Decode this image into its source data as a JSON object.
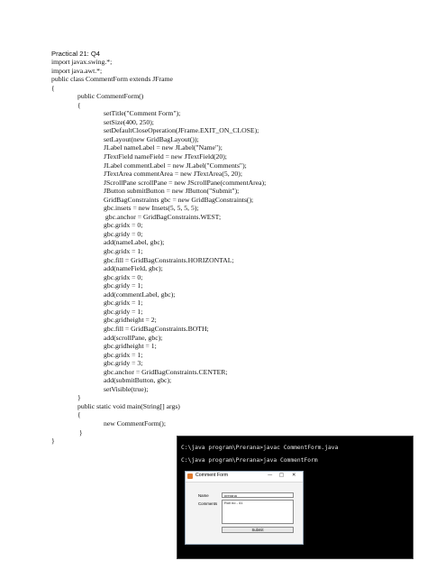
{
  "heading": "Practical 21: Q4",
  "code_lines": [
    {
      "indent": 0,
      "text": "import javax.swing.*;"
    },
    {
      "indent": 0,
      "text": "import java.awt.*;"
    },
    {
      "indent": 0,
      "text": "public class CommentForm extends JFrame"
    },
    {
      "indent": 0,
      "text": "{"
    },
    {
      "indent": 1,
      "text": "public CommentForm()"
    },
    {
      "indent": 1,
      "text": "{"
    },
    {
      "indent": 2,
      "text": "setTitle(\"Comment Form\");"
    },
    {
      "indent": 2,
      "text": "setSize(400, 250);"
    },
    {
      "indent": 2,
      "text": "setDefaultCloseOperation(JFrame.EXIT_ON_CLOSE);"
    },
    {
      "indent": 2,
      "text": "setLayout(new GridBagLayout());"
    },
    {
      "indent": 2,
      "text": "JLabel nameLabel = new JLabel(\"Name\");"
    },
    {
      "indent": 2,
      "text": "JTextField nameField = new JTextField(20);"
    },
    {
      "indent": 2,
      "text": "JLabel commentLabel = new JLabel(\"Comments\");"
    },
    {
      "indent": 2,
      "text": "JTextArea commentArea = new JTextArea(5, 20);"
    },
    {
      "indent": 2,
      "text": "JScrollPane scrollPane = new JScrollPane(commentArea);"
    },
    {
      "indent": 2,
      "text": "JButton submitButton = new JButton(\"Submit\");"
    },
    {
      "indent": 2,
      "text": "GridBagConstraints gbc = new GridBagConstraints();"
    },
    {
      "indent": 2,
      "text": "gbc.insets = new Insets(5, 5, 5, 5);"
    },
    {
      "indent": 2,
      "text": " gbc.anchor = GridBagConstraints.WEST;"
    },
    {
      "indent": 2,
      "text": "gbc.gridx = 0;"
    },
    {
      "indent": 2,
      "text": "gbc.gridy = 0;"
    },
    {
      "indent": 2,
      "text": "add(nameLabel, gbc);"
    },
    {
      "indent": 2,
      "text": "gbc.gridx = 1;"
    },
    {
      "indent": 2,
      "text": "gbc.fill = GridBagConstraints.HORIZONTAL;"
    },
    {
      "indent": 2,
      "text": "add(nameField, gbc);"
    },
    {
      "indent": 2,
      "text": "gbc.gridx = 0;"
    },
    {
      "indent": 2,
      "text": "gbc.gridy = 1;"
    },
    {
      "indent": 2,
      "text": "add(commentLabel, gbc);"
    },
    {
      "indent": 2,
      "text": "gbc.gridx = 1;"
    },
    {
      "indent": 2,
      "text": "gbc.gridy = 1;"
    },
    {
      "indent": 2,
      "text": "gbc.gridheight = 2;"
    },
    {
      "indent": 2,
      "text": "gbc.fill = GridBagConstraints.BOTH;"
    },
    {
      "indent": 2,
      "text": "add(scrollPane, gbc);"
    },
    {
      "indent": 2,
      "text": "gbc.gridheight = 1;"
    },
    {
      "indent": 2,
      "text": "gbc.gridx = 1;"
    },
    {
      "indent": 2,
      "text": "gbc.gridy = 3;"
    },
    {
      "indent": 2,
      "text": "gbc.anchor = GridBagConstraints.CENTER;"
    },
    {
      "indent": 2,
      "text": "add(submitButton, gbc);"
    },
    {
      "indent": 2,
      "text": "setVisible(true);"
    },
    {
      "indent": 1,
      "text": "}"
    },
    {
      "indent": 1,
      "text": "public static void main(String[] args)"
    },
    {
      "indent": 1,
      "text": "{"
    },
    {
      "indent": 2,
      "text": "new CommentForm();"
    },
    {
      "indent": 1,
      "text": " }"
    },
    {
      "indent": 0,
      "text": "}"
    }
  ],
  "terminal": {
    "line1": "C:\\java program\\Prerana>javac CommentForm.java",
    "line2": "C:\\java program\\Prerana>java CommentForm",
    "window": {
      "title": "Comment Form",
      "minimize_icon": "minimize-icon",
      "maximize_icon": "maximize-icon",
      "close_icon": "close-icon",
      "name_label": "Name",
      "name_value": "prerana",
      "comments_label": "Comments",
      "comments_value": "Roll no - 41",
      "submit_label": "Submit"
    }
  }
}
